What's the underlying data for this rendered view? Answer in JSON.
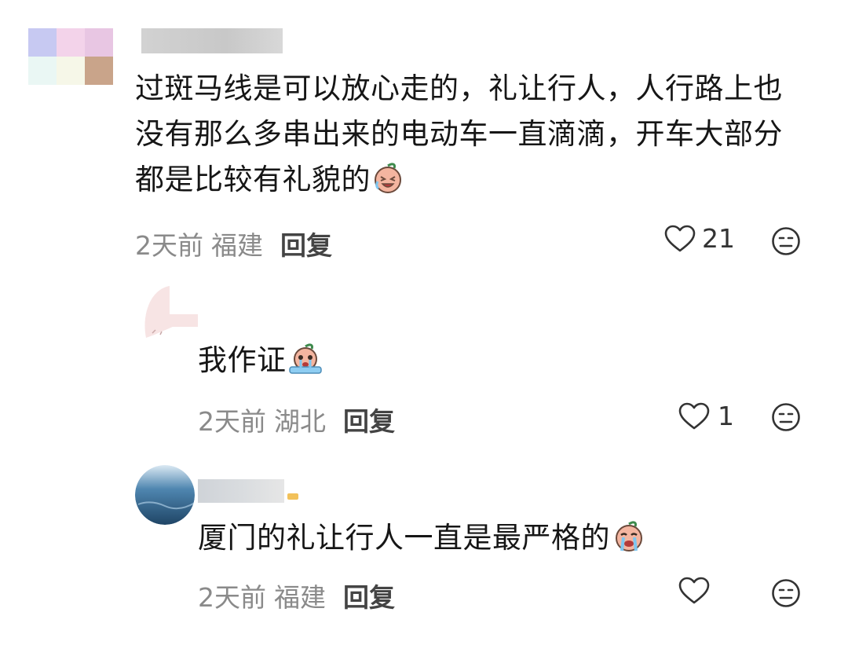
{
  "comments": [
    {
      "text_lines": [
        "过斑马线是可以放心走的，礼让行人，人行路上也",
        "没有那么多串出来的电动车一直滴滴，开车大部分",
        "都是比较有礼貌的"
      ],
      "emoji": "laughing-crying-emoji",
      "time": "2天前",
      "location": "福建",
      "reply_label": "回复",
      "likes": "21"
    },
    {
      "text": "我作证",
      "emoji": "crying-emoji",
      "time": "2天前",
      "location": "湖北",
      "reply_label": "回复",
      "likes": "1"
    },
    {
      "text": "厦门的礼让行人一直是最严格的",
      "emoji": "crying-emoji",
      "time": "2天前",
      "location": "福建",
      "reply_label": "回复",
      "likes": ""
    }
  ],
  "icons": {
    "like": "heart-outline-icon",
    "dislike": "neutral-face-icon"
  },
  "colors": {
    "meta_text": "#8a8a8a",
    "reply_text": "#444444",
    "icon_stroke": "#333333"
  }
}
